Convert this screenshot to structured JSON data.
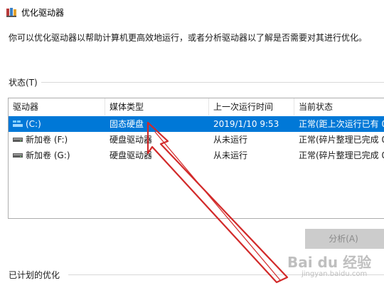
{
  "window": {
    "title": "优化驱动器",
    "description": "你可以优化驱动器以帮助计算机更高效地运行，或者分析驱动器以了解是否需要对其进行优化。"
  },
  "status_group": {
    "label": "状态(T)"
  },
  "columns": {
    "drive": "驱动器",
    "media_type": "媒体类型",
    "last_run": "上一次运行时间",
    "current_status": "当前状态"
  },
  "drives": [
    {
      "name": "(C:)",
      "media_type": "固态硬盘",
      "last_run": "2019/1/10 9:53",
      "status": "正常(距上次运行已有 0",
      "selected": true,
      "icon": "windows-drive-icon"
    },
    {
      "name": "新加卷 (F:)",
      "media_type": "硬盘驱动器",
      "last_run": "从未运行",
      "status": "正常(碎片整理已完成 0",
      "selected": false,
      "icon": "hard-drive-icon"
    },
    {
      "name": "新加卷 (G:)",
      "media_type": "硬盘驱动器",
      "last_run": "从未运行",
      "status": "正常(碎片整理已完成 0",
      "selected": false,
      "icon": "hard-drive-icon"
    }
  ],
  "analyze_button": {
    "label": "分析(A)"
  },
  "scheduled_group": {
    "label": "已计划的优化"
  },
  "watermark": {
    "brand": "Bai du 经验",
    "url": "jingyan.baidu.com"
  },
  "colors": {
    "selection": "#0078d7",
    "arrow": "#d22a2a"
  }
}
